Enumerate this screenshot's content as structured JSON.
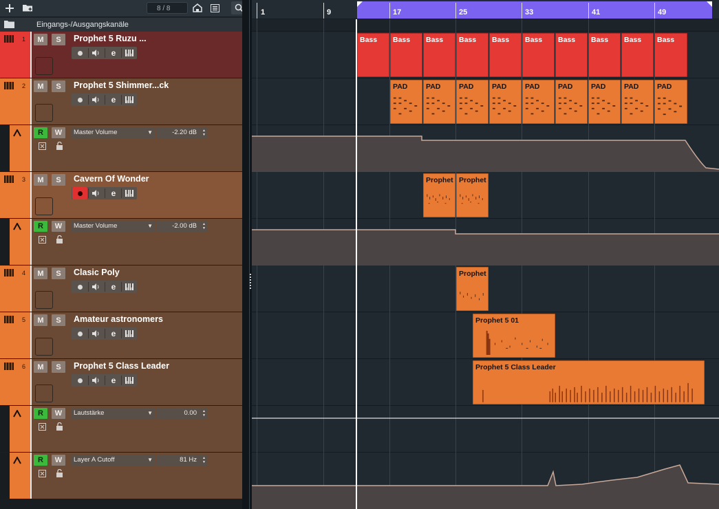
{
  "toolbar": {
    "counter": "8 / 8"
  },
  "ruler": {
    "labels": [
      "1",
      "9",
      "17",
      "25",
      "33",
      "41",
      "49"
    ]
  },
  "folder": {
    "name": "Eingangs-/Ausgangskanäle"
  },
  "colors": {
    "track_red": "#e53935",
    "track_orange": "#e87a33",
    "track_body_red": "#6b2a2a",
    "track_body_brown": "#6a4a34",
    "loop_region": "#7b62f0",
    "read_green": "#3cb83c",
    "record_red": "#e03030"
  },
  "tracks": [
    {
      "number": "1",
      "name": "Prophet 5 Ruzu ...",
      "color": "red",
      "record_armed": false
    },
    {
      "number": "2",
      "name": "Prophet 5 Shimmer...ck",
      "color": "orange",
      "record_armed": false
    },
    {
      "number": "3",
      "name": "Cavern Of Wonder",
      "color": "orange",
      "record_armed": true
    },
    {
      "number": "4",
      "name": "Clasic Poly",
      "color": "orange",
      "record_armed": false
    },
    {
      "number": "5",
      "name": "Amateur astronomers",
      "color": "orange",
      "record_armed": false
    },
    {
      "number": "6",
      "name": "Prophet 5 Class Leader",
      "color": "orange",
      "record_armed": false
    }
  ],
  "automation": [
    {
      "parameter": "Master Volume",
      "value": "-2.20 dB"
    },
    {
      "parameter": "Master Volume",
      "value": "-2.00 dB"
    },
    {
      "parameter": "Lautstärke",
      "value": "0.00"
    },
    {
      "parameter": "Layer A Cutoff",
      "value": "81 Hz"
    }
  ],
  "buttons": {
    "mute": "M",
    "solo": "S",
    "read": "R",
    "write": "W",
    "edit": "e"
  },
  "parts": {
    "track1": "Bass",
    "track2": "PAD",
    "track3": "Prophet",
    "track4": "Prophet",
    "track5": "Prophet 5 01",
    "track6": "Prophet 5 Class Leader"
  }
}
